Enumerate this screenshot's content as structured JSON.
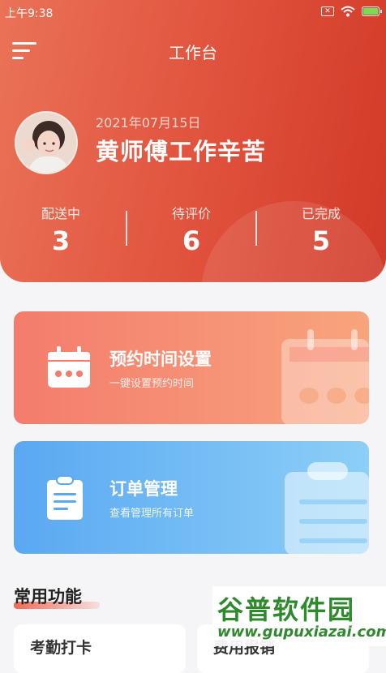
{
  "status_bar": {
    "time": "上午9:38"
  },
  "header": {
    "title": "工作台"
  },
  "profile": {
    "date": "2021年07月15日",
    "greeting": "黄师傅工作辛苦"
  },
  "stats": [
    {
      "label": "配送中",
      "value": "3"
    },
    {
      "label": "待评价",
      "value": "6"
    },
    {
      "label": "已完成",
      "value": "5"
    }
  ],
  "cards": {
    "schedule": {
      "title": "预约时间设置",
      "subtitle": "一键设置预约时间",
      "icon": "calendar-icon"
    },
    "orders": {
      "title": "订单管理",
      "subtitle": "查看管理所有订单",
      "icon": "clipboard-icon"
    }
  },
  "section": {
    "title": "常用功能"
  },
  "functions": [
    {
      "label": "考勤打卡"
    },
    {
      "label": "费用报销"
    }
  ],
  "watermark": {
    "title": "谷普软件园",
    "url": "www.gupuxiazai.com"
  },
  "colors": {
    "header_start": "#ea7257",
    "header_end": "#d13a28",
    "orders_card": "#5aa8f2",
    "accent": "#f06a55"
  }
}
